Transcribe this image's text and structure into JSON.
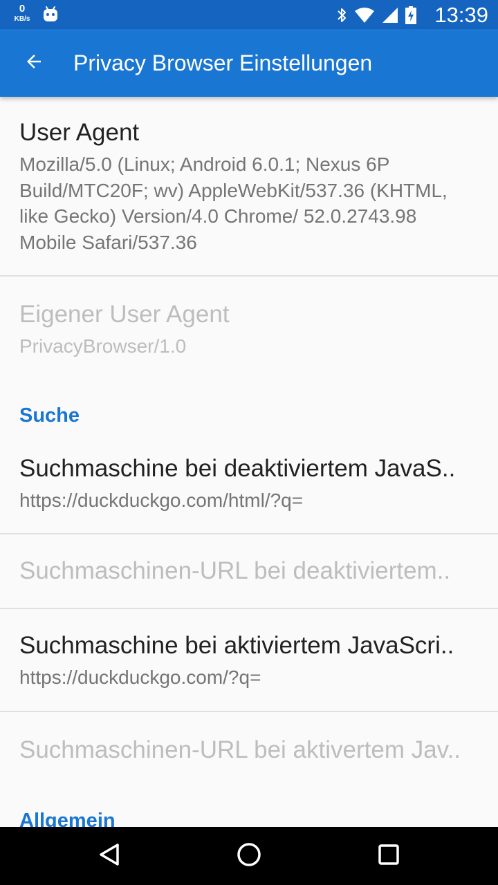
{
  "status_bar": {
    "net_speed_value": "0",
    "net_speed_unit": "KB/s",
    "time": "13:39",
    "icons": [
      "android-notification-icon",
      "bluetooth-icon",
      "wifi-icon",
      "signal-icon",
      "battery-charging-icon"
    ]
  },
  "app_bar": {
    "back_icon": "arrow-back-icon",
    "title": "Privacy Browser Einstellungen"
  },
  "preferences": {
    "user_agent": {
      "title": "User Agent",
      "summary": "Mozilla/5.0 (Linux; Android 6.0.1; Nexus 6P Build/MTC20F; wv) AppleWebKit/537.36 (KHTML, like Gecko) Version/4.0 Chrome/ 52.0.2743.98 Mobile Safari/537.36"
    },
    "custom_user_agent": {
      "title": "Eigener User Agent",
      "summary": "PrivacyBrowser/1.0",
      "enabled": false
    },
    "category_search": "Suche",
    "search_js_disabled": {
      "title": "Suchmaschine bei deaktiviertem JavaS..",
      "summary": "https://duckduckgo.com/html/?q="
    },
    "search_url_js_disabled": {
      "title": "Suchmaschinen-URL bei deaktiviertem..",
      "enabled": false
    },
    "search_js_enabled": {
      "title": "Suchmaschine bei aktiviertem JavaScri..",
      "summary": "https://duckduckgo.com/?q="
    },
    "search_url_js_enabled": {
      "title": "Suchmaschinen-URL bei aktivertem Jav..",
      "enabled": false
    },
    "category_general": "Allgemein"
  },
  "nav_bar": {
    "buttons": [
      "back-triangle-icon",
      "home-circle-icon",
      "recents-square-icon"
    ]
  },
  "colors": {
    "status_bar": "#1565c0",
    "app_bar": "#1976d2",
    "accent": "#1976d2",
    "background": "#fafafa"
  }
}
